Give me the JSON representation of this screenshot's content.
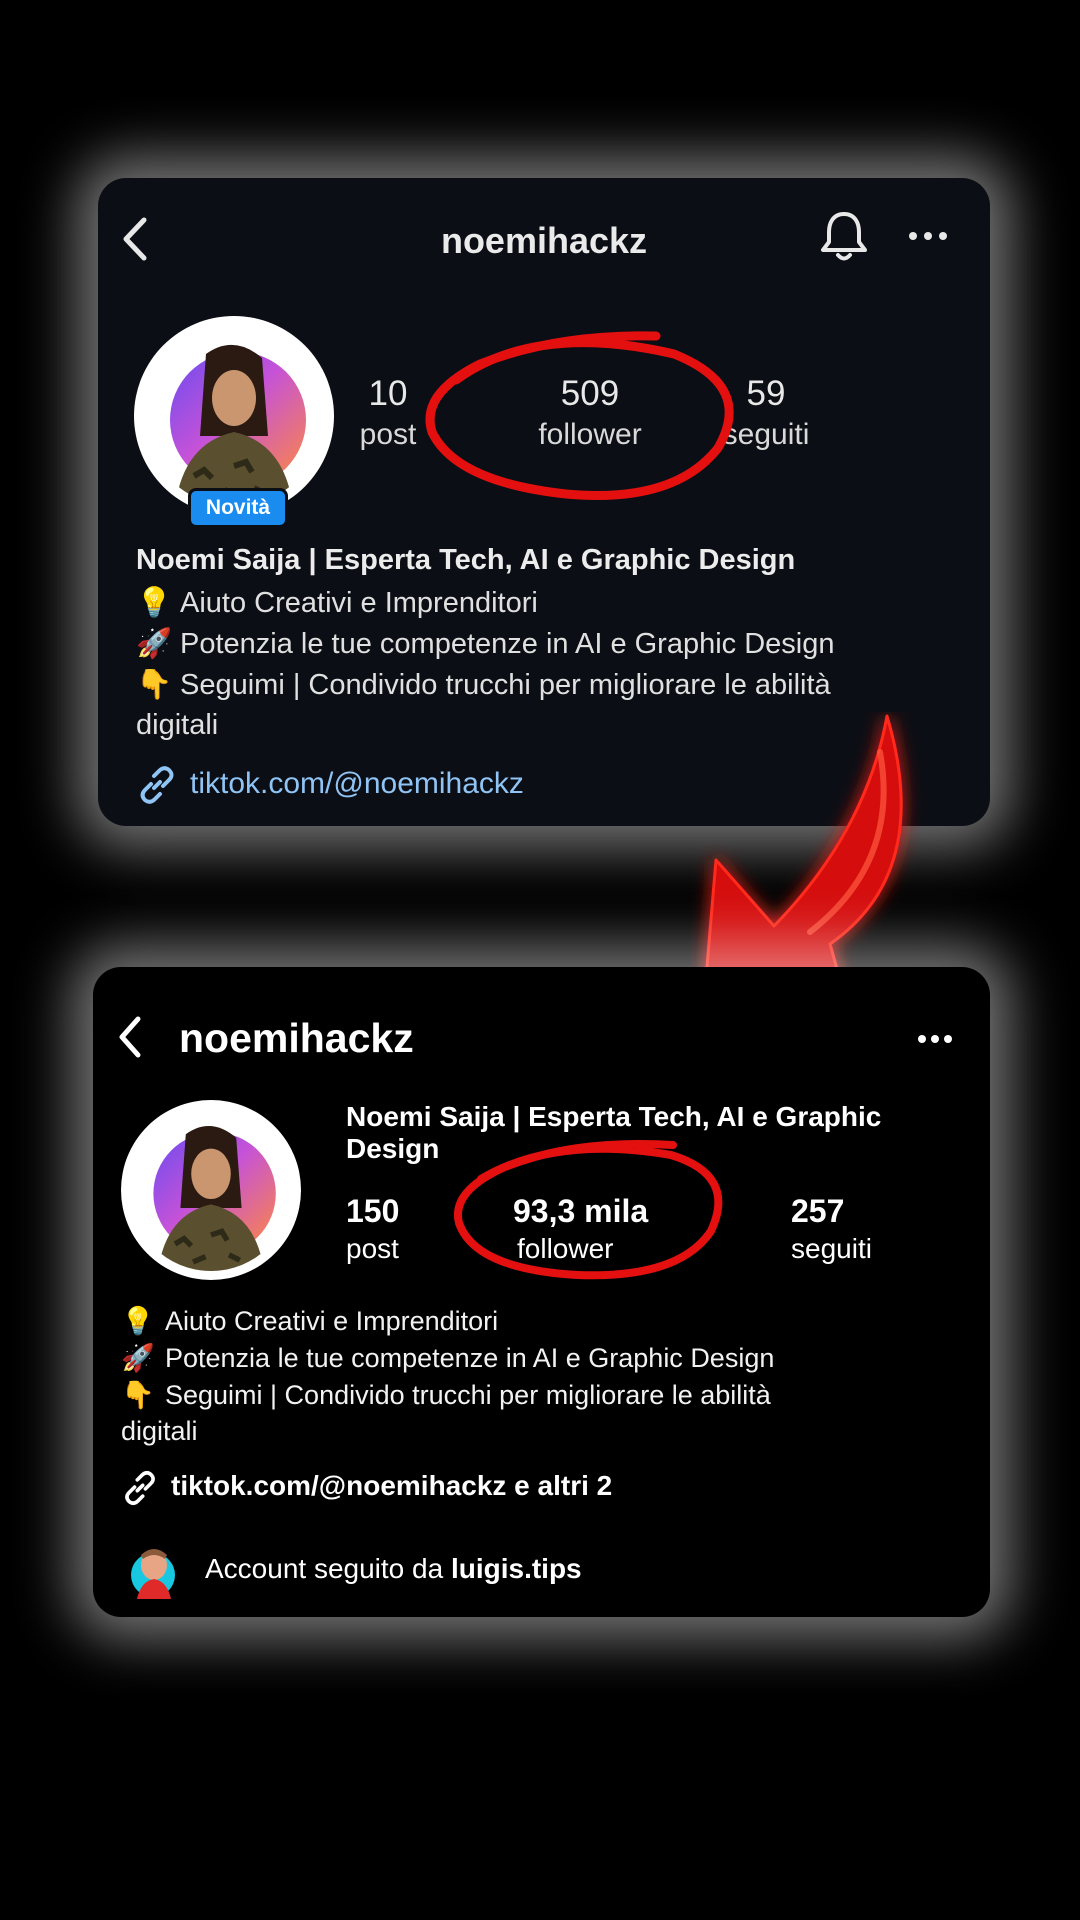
{
  "profile_before": {
    "username": "noemihackz",
    "badge": "Novità",
    "stats": {
      "posts_value": "10",
      "posts_label": "post",
      "followers_value": "509",
      "followers_label": "follower",
      "following_value": "59",
      "following_label": "seguiti"
    },
    "name": "Noemi Saija | Esperta Tech, AI e Graphic Design",
    "bio": [
      {
        "icon": "lightbulb-icon",
        "text": "Aiuto Creativi e Imprenditori"
      },
      {
        "icon": "rocket-icon",
        "text": "Potenzia le tue competenze in AI e Graphic Design"
      },
      {
        "icon": "pointing-down-icon",
        "text": "Seguimi | Condivido trucchi per migliorare le abilità"
      }
    ],
    "bio_continuation": "digitali",
    "link": "tiktok.com/@noemihackz",
    "colors": {
      "link": "#8fc4f5",
      "badge": "#1a8cf0"
    }
  },
  "profile_after": {
    "username": "noemihackz",
    "name_line1": "Noemi Saija | Esperta Tech, AI e Graphic",
    "name_line2": "Design",
    "stats": {
      "posts_value": "150",
      "posts_label": "post",
      "followers_value": "93,3 mila",
      "followers_label": "follower",
      "following_value": "257",
      "following_label": "seguiti"
    },
    "bio": [
      {
        "icon": "lightbulb-icon",
        "text": "Aiuto Creativi e Imprenditori"
      },
      {
        "icon": "rocket-icon",
        "text": "Potenzia le tue competenze in AI e Graphic Design"
      },
      {
        "icon": "pointing-down-icon",
        "text": "Seguimi | Condivido trucchi per migliorare le abilità"
      }
    ],
    "bio_continuation": "digitali",
    "link": "tiktok.com/@noemihackz e altri 2",
    "followed_by_prefix": "Account seguito da",
    "followed_by_user": "luigis.tips"
  },
  "colors": {
    "highlight": "#e4100f",
    "glow": "#ffffff"
  }
}
